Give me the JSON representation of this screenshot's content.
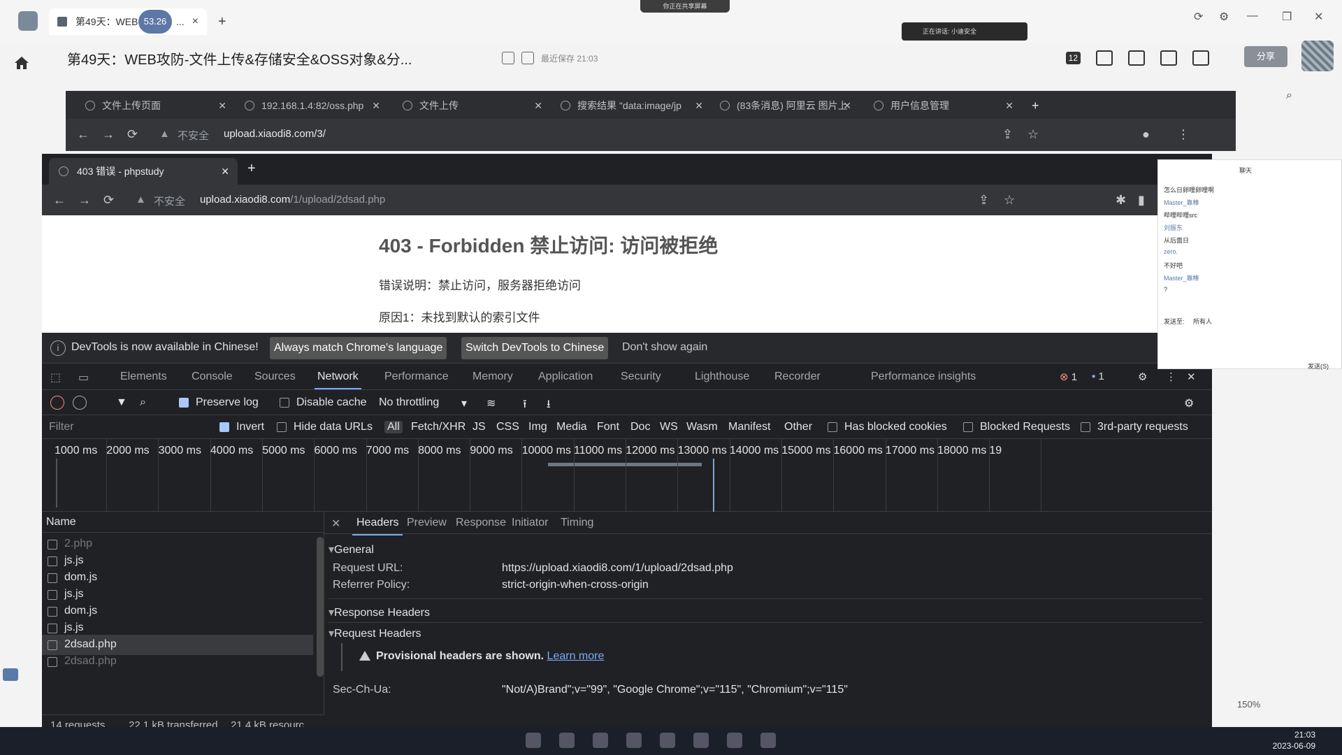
{
  "app": {
    "tab_label": "第49天：WEB",
    "tab_ellipsis": "...",
    "badge": "53.26",
    "recording_label": "你正在共享屏幕",
    "live_label": "正在讲话: 小迪安全",
    "doc_title": "第49天：WEB攻防-文件上传&存储安全&OSS对象&分...",
    "doc_meta": "最近保存 21:03",
    "notif_count": "12",
    "share_label": "分享",
    "zoom": "150%"
  },
  "back_browser": {
    "tabs": [
      {
        "label": "文件上传页面"
      },
      {
        "label": "192.168.1.4:82/oss.php"
      },
      {
        "label": "文件上传"
      },
      {
        "label": "搜索结果 \"data:image/jp"
      },
      {
        "label": "(83条消息) 阿里云 图片上"
      },
      {
        "label": "用户信息管理"
      }
    ],
    "security": "不安全",
    "url": "upload.xiaodi8.com/3/"
  },
  "front_browser": {
    "tab_label": "403 错误 - phpstudy",
    "security": "不安全",
    "url_host": "upload.xiaodi8.com",
    "url_path": "/1/upload/2dsad.php"
  },
  "page": {
    "title": "403 - Forbidden 禁止访问: 访问被拒绝",
    "line1": "错误说明：禁止访问，服务器拒绝访问",
    "line2": "原因1：未找到默认的索引文件"
  },
  "devtools": {
    "infobar": {
      "text": "DevTools is now available in Chinese!",
      "btn_match": "Always match Chrome's language",
      "btn_switch": "Switch DevTools to Chinese",
      "dismiss": "Don't show again"
    },
    "tabs": [
      "Elements",
      "Console",
      "Sources",
      "Network",
      "Performance",
      "Memory",
      "Application",
      "Security",
      "Lighthouse",
      "Recorder",
      "Performance insights"
    ],
    "active_tab": "Network",
    "error_count": "1",
    "msg_count": "1",
    "toolbar": {
      "preserve_log": "Preserve log",
      "disable_cache": "Disable cache",
      "throttling": "No throttling"
    },
    "filter": {
      "placeholder": "Filter",
      "invert": "Invert",
      "hide_data_urls": "Hide data URLs",
      "types": [
        "All",
        "Fetch/XHR",
        "JS",
        "CSS",
        "Img",
        "Media",
        "Font",
        "Doc",
        "WS",
        "Wasm",
        "Manifest",
        "Other"
      ],
      "has_blocked_cookies": "Has blocked cookies",
      "blocked_requests": "Blocked Requests",
      "third_party": "3rd-party requests"
    },
    "timeline_labels": [
      "1000 ms",
      "2000 ms",
      "3000 ms",
      "4000 ms",
      "5000 ms",
      "6000 ms",
      "7000 ms",
      "8000 ms",
      "9000 ms",
      "10000 ms",
      "11000 ms",
      "12000 ms",
      "13000 ms",
      "14000 ms",
      "15000 ms",
      "16000 ms",
      "17000 ms",
      "18000 ms",
      "19"
    ],
    "requests_header": "Name",
    "requests": [
      {
        "name": "2.php",
        "state": "dim"
      },
      {
        "name": "js.js",
        "state": ""
      },
      {
        "name": "dom.js",
        "state": ""
      },
      {
        "name": "js.js",
        "state": ""
      },
      {
        "name": "dom.js",
        "state": ""
      },
      {
        "name": "js.js",
        "state": ""
      },
      {
        "name": "2dsad.php",
        "state": "sel"
      },
      {
        "name": "2dsad.php",
        "state": "dim"
      }
    ],
    "status": {
      "requests": "14 requests",
      "transferred": "22.1 kB transferred",
      "resources": "21.4 kB resourc"
    },
    "detail_tabs": [
      "Headers",
      "Preview",
      "Response",
      "Initiator",
      "Timing"
    ],
    "general": {
      "heading": "General",
      "request_url_label": "Request URL:",
      "request_url": "https://upload.xiaodi8.com/1/upload/2dsad.php",
      "referrer_label": "Referrer Policy:",
      "referrer": "strict-origin-when-cross-origin"
    },
    "response_headers": "Response Headers",
    "request_headers": "Request Headers",
    "provisional_bold": "Provisional headers are shown.",
    "learn_more": "Learn more",
    "sec_ch_label": "Sec-Ch-Ua:",
    "sec_ch_value": "\"Not/A)Brand\";v=\"99\", \"Google Chrome\";v=\"115\", \"Chromium\";v=\"115\""
  },
  "chat": {
    "title": "聊天",
    "messages": [
      {
        "text": "怎么日卵哩卵哩啊",
        "name": false
      },
      {
        "text": "Master_靠棒",
        "name": true
      },
      {
        "text": "哔哩哔哩src",
        "name": false
      },
      {
        "text": "刘振东",
        "name": true
      },
      {
        "text": "从后面日",
        "name": false
      },
      {
        "text": "zero.",
        "name": true
      },
      {
        "text": "不好吧",
        "name": false
      },
      {
        "text": "Master_靠棒",
        "name": true
      },
      {
        "text": "?",
        "name": false
      }
    ],
    "send_to": "发送至:",
    "recipient": "所有人",
    "footer": "发送(S)"
  },
  "taskbar": {
    "time": "21:03",
    "date": "2023-06-09"
  }
}
